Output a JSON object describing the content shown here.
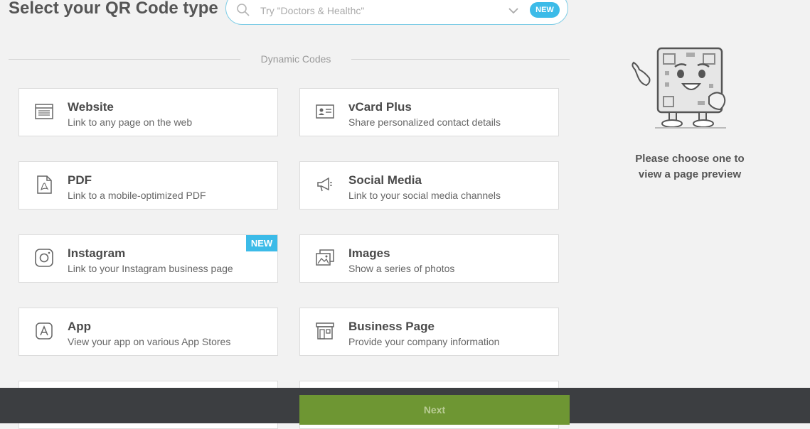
{
  "header": {
    "title": "Select your QR Code type",
    "search": {
      "placeholder": "Try \"Doctors & Healthc\"",
      "badge": "NEW"
    }
  },
  "section": {
    "label": "Dynamic Codes"
  },
  "codes": [
    {
      "name": "Website",
      "desc": "Link to any page on the web",
      "icon": "browser-window-icon"
    },
    {
      "name": "vCard Plus",
      "desc": "Share personalized contact details",
      "icon": "contact-card-icon"
    },
    {
      "name": "PDF",
      "desc": "Link to a mobile-optimized PDF",
      "icon": "pdf-file-icon"
    },
    {
      "name": "Social Media",
      "desc": "Link to your social media channels",
      "icon": "megaphone-icon"
    },
    {
      "name": "Instagram",
      "desc": "Link to your Instagram business page",
      "icon": "instagram-icon",
      "tag": "NEW"
    },
    {
      "name": "Images",
      "desc": "Show a series of photos",
      "icon": "images-icon"
    },
    {
      "name": "App",
      "desc": "View your app on various App Stores",
      "icon": "app-store-icon"
    },
    {
      "name": "Business Page",
      "desc": "Provide your company information",
      "icon": "storefront-icon"
    }
  ],
  "preview": {
    "text": "Please choose one to view a page preview"
  },
  "footer": {
    "next_label": "Next"
  },
  "colors": {
    "accent": "#3cbbe8",
    "next": "#6e9633",
    "footer": "#3c3e41"
  }
}
